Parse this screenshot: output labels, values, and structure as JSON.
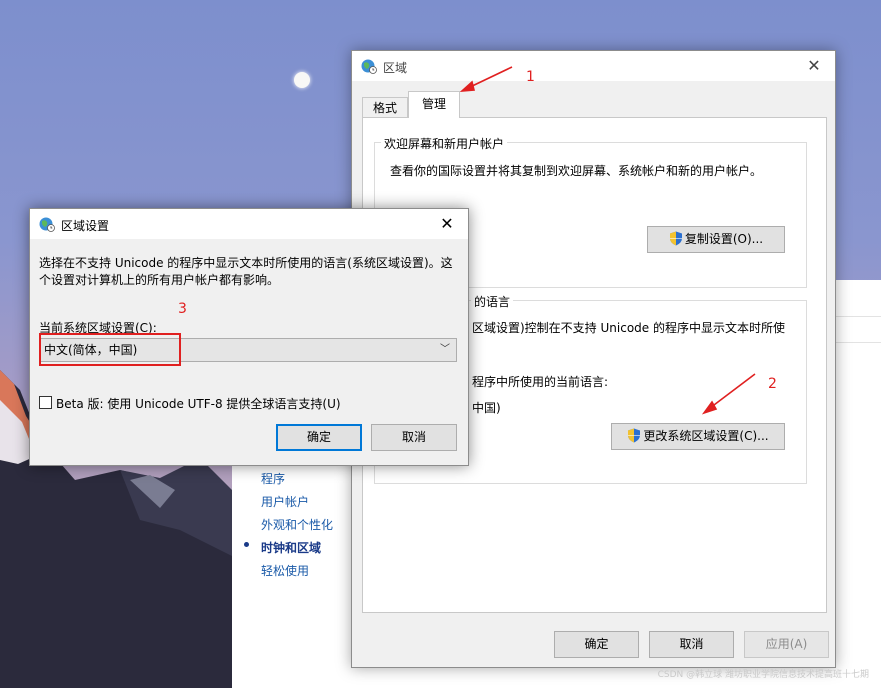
{
  "background_panel": {
    "links": [
      "程序",
      "用户帐户",
      "外观和个性化",
      "时钟和区域",
      "轻松使用"
    ],
    "active_link": "时钟和区域"
  },
  "region_window": {
    "title": "区域",
    "close_glyph": "✕",
    "tabs": [
      {
        "label": "格式",
        "selected": false
      },
      {
        "label": "管理",
        "selected": true
      }
    ],
    "welcome_group": {
      "label": "欢迎屏幕和新用户帐户",
      "description": "查看你的国际设置并将其复制到欢迎屏幕、系统帐户和新的用户帐户。",
      "copy_button": "复制设置(O)..."
    },
    "non_unicode_group": {
      "label_partial": "的语言",
      "line1_partial": "区域设置)控制在不支持 Unicode 的程序中显示文本时所使",
      "line2_partial": "程序中所使用的当前语言:",
      "line3_partial": "中国)",
      "change_button": "更改系统区域设置(C)..."
    },
    "footer": {
      "ok": "确定",
      "cancel": "取消",
      "apply": "应用(A)"
    }
  },
  "locale_dialog": {
    "title": "区域设置",
    "close_glyph": "✕",
    "description": "选择在不支持 Unicode 的程序中显示文本时所使用的语言(系统区域设置)。这个设置对计算机上的所有用户帐户都有影响。",
    "current_label": "当前系统区域设置(C):",
    "selected_locale": "中文(简体，中国)",
    "beta_checkbox_label": "Beta 版: 使用 Unicode UTF-8 提供全球语言支持(U)",
    "beta_checked": false,
    "ok": "确定",
    "cancel": "取消"
  },
  "annotations": {
    "n1": "1",
    "n2": "2",
    "n3": "3",
    "color": "#e02020"
  },
  "watermark": "CSDN @韩立球  潍坊职业学院信息技术提高班十七期"
}
